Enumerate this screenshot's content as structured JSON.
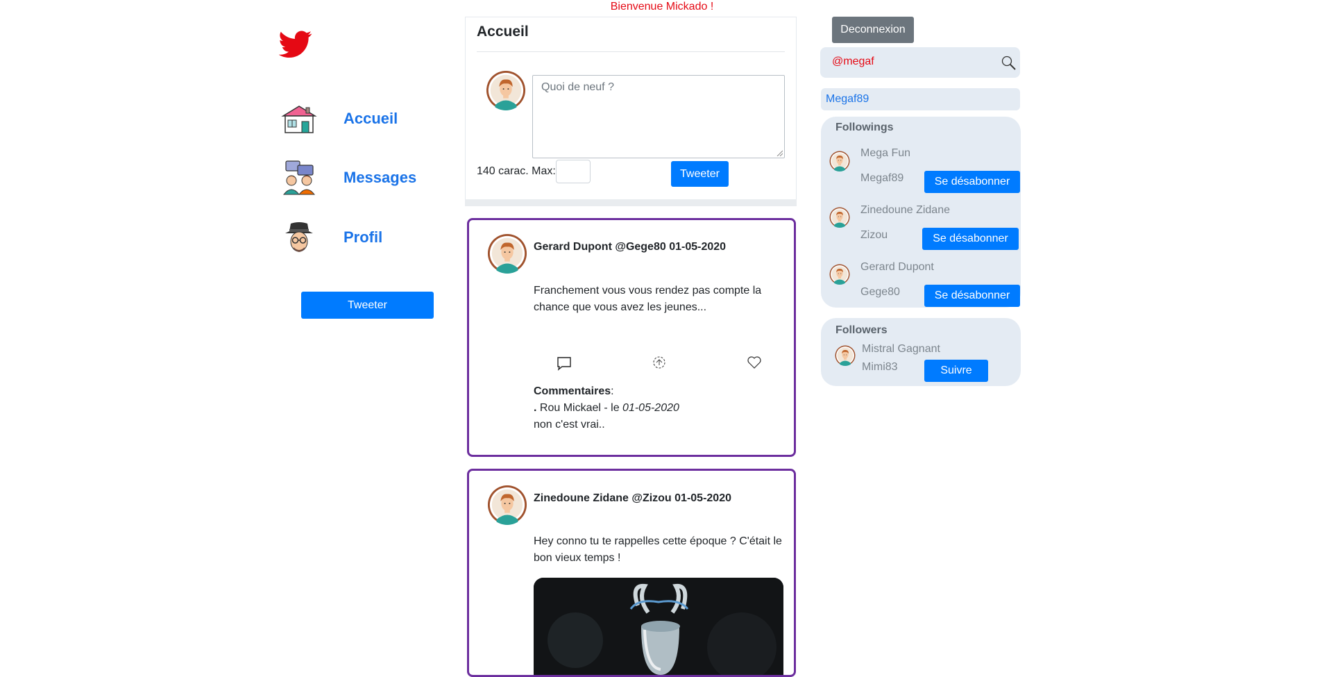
{
  "header": {
    "welcome": "Bienvenue Mickado  !"
  },
  "nav": {
    "items": [
      {
        "label": "Accueil",
        "icon": "house-icon"
      },
      {
        "label": "Messages",
        "icon": "chat-users-icon"
      },
      {
        "label": "Profil",
        "icon": "profile-avatar-icon"
      }
    ],
    "tweet_button": "Tweeter"
  },
  "composer": {
    "title": "Accueil",
    "placeholder": "Quoi de neuf ?",
    "char_label": "140 carac. Max:",
    "tweet_button": "Tweeter"
  },
  "tweets": [
    {
      "header": "Gerard Dupont @Gege80 01-05-2020",
      "body": "Franchement vous vous rendez pas compte la chance que vous avez les jeunes...",
      "comments_label": "Commentaires",
      "comments_colon": ":",
      "comment_prefix": ". ",
      "comment_author": "Rou Mickael - le ",
      "comment_date": "01-05-2020",
      "comment_text": "non c'est vrai.."
    },
    {
      "header": "Zinedoune Zidane @Zizou 01-05-2020",
      "body": "Hey conno tu te rappelles cette époque ? C'était le bon vieux temps !"
    }
  ],
  "sidebar": {
    "logout": "Deconnexion",
    "search_value": "@megaf",
    "search_result": "Megaf89",
    "followings_title": "Followings",
    "followings": [
      {
        "name": "Mega Fun",
        "handle": "Megaf89",
        "button": "Se désabonner"
      },
      {
        "name": "Zinedoune Zidane",
        "handle": "Zizou",
        "button": "Se désabonner"
      },
      {
        "name": "Gerard Dupont",
        "handle": "Gege80",
        "button": "Se désabonner"
      }
    ],
    "followers_title": "Followers",
    "followers": [
      {
        "name": "Mistral Gagnant",
        "handle": "Mimi83",
        "button": "Suivre"
      }
    ]
  },
  "colors": {
    "brand_red": "#e50914",
    "link_blue": "#1a73e8",
    "primary": "#007bff",
    "tweet_border": "#6c2e9e",
    "panel_bg": "#e4ebf3"
  }
}
